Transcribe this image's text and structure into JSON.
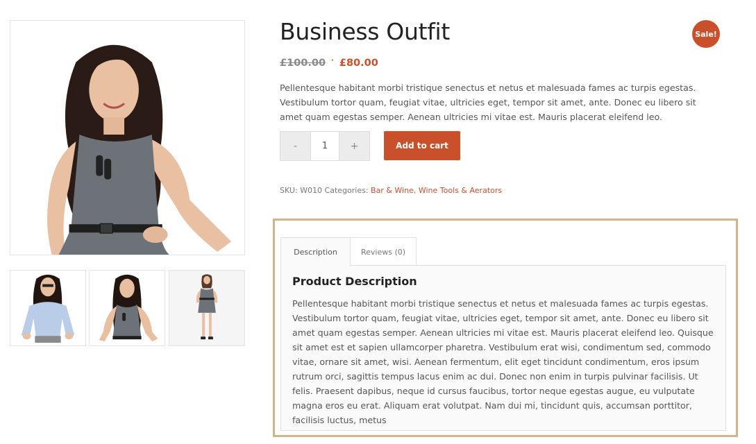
{
  "product": {
    "title": "Business Outfit",
    "sale_badge": "Sale!",
    "price_old": "£100.00",
    "price_separator": "·",
    "price_new": "£80.00",
    "short_description": "Pellentesque habitant morbi tristique senectus et netus et malesuada fames ac turpis egestas. Vestibulum tortor quam, feugiat vitae, ultricies eget, tempor sit amet, ante. Donec eu libero sit amet quam egestas semper. Aenean ultricies mi vitae est. Mauris placerat eleifend leo."
  },
  "cart": {
    "minus_label": "-",
    "quantity": "1",
    "plus_label": "+",
    "add_to_cart_label": "Add to cart"
  },
  "meta": {
    "sku_label": "SKU:",
    "sku_value": "W010",
    "categories_label": "Categories:",
    "categories": [
      "Bar & Wine",
      "Wine Tools & Aerators"
    ],
    "category_separator": ","
  },
  "tabs": [
    {
      "label": "Description"
    },
    {
      "label": "Reviews (0)"
    }
  ],
  "description_panel": {
    "heading": "Product Description",
    "text": "Pellentesque habitant morbi tristique senectus et netus et malesuada fames ac turpis egestas. Vestibulum tortor quam, feugiat vitae, ultricies eget, tempor sit amet, ante. Donec eu libero sit amet quam egestas semper. Aenean ultricies mi vitae est. Mauris placerat eleifend leo. Quisque sit amet est et sapien ullamcorper pharetra. Vestibulum erat wisi, condimentum sed, commodo vitae, ornare sit amet, wisi. Aenean fermentum, elit eget tincidunt condimentum, eros ipsum rutrum orci, sagittis tempus lacus enim ac dui. Donec non enim in turpis pulvinar facilisis. Ut felis. Praesent dapibus, neque id cursus faucibus, tortor neque egestas augue, eu vulputate magna eros eu erat. Aliquam erat volutpat. Nam dui mi, tincidunt quis, accumsan porttitor, facilisis luctus, metus"
  },
  "colors": {
    "accent": "#c9502b",
    "highlight_frame": "#d2b48c"
  },
  "icons": {
    "main_image": "woman-grey-dress-photo",
    "thumb_1": "woman-blue-shirt-photo",
    "thumb_2": "woman-grey-dress-photo",
    "thumb_3": "woman-full-body-photo"
  }
}
